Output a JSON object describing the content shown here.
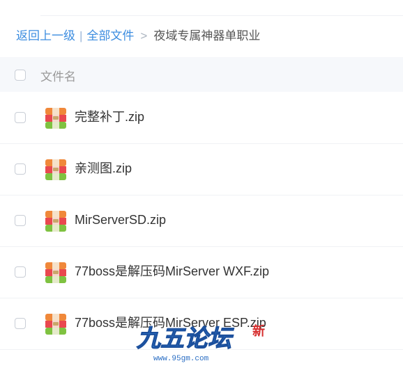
{
  "breadcrumb": {
    "back": "返回上一级",
    "separator": "|",
    "root": "全部文件",
    "arrow": ">",
    "current": "夜域专属神器单职业"
  },
  "table": {
    "header": "文件名",
    "files": [
      {
        "name": "完整补丁.zip",
        "icon": "zip-archive-icon"
      },
      {
        "name": "亲测图.zip",
        "icon": "zip-archive-icon"
      },
      {
        "name": "MirServerSD.zip",
        "icon": "zip-archive-icon"
      },
      {
        "name": "77boss是解压码MirServer WXF.zip",
        "icon": "zip-archive-icon"
      },
      {
        "name": "77boss是解压码MirServer ESP.zip",
        "icon": "zip-archive-icon"
      }
    ]
  },
  "watermark": {
    "logo_text": "九五论坛",
    "badge": "新",
    "url": "www.95gm.com"
  },
  "colors": {
    "link": "#3c8de0",
    "header_bg": "#f6f8fb",
    "zip_orange": "#f0883a",
    "zip_red": "#e9484f",
    "zip_green": "#7fc241"
  }
}
